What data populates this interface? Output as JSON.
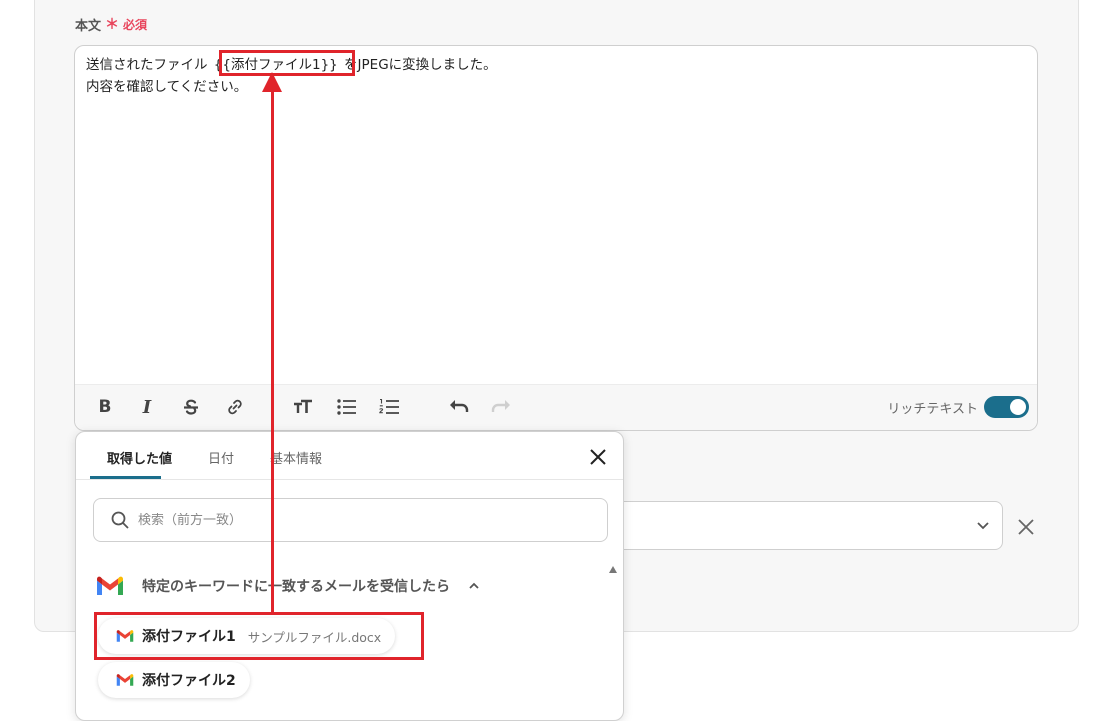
{
  "field": {
    "label": "本文",
    "required_mark": "＊",
    "required_text": "必須"
  },
  "editor": {
    "line1_before": "送信されたファイル ",
    "line1_token": "{{添付ファイル1}}",
    "line1_after": " をJPEGに変換しました。",
    "line2": "内容を確認してください。"
  },
  "toolbar": {
    "bold_label": "B",
    "italic_label": "I",
    "rich_text_label": "リッチテキスト",
    "rich_text_enabled": true,
    "icons": [
      "bold-icon",
      "italic-icon",
      "strikethrough-icon",
      "link-icon",
      "text-size-icon",
      "bullet-list-icon",
      "numbered-list-icon",
      "undo-icon",
      "redo-icon"
    ]
  },
  "popup": {
    "tabs": [
      {
        "label": "取得した値",
        "active": true
      },
      {
        "label": "日付",
        "active": false
      },
      {
        "label": "基本情報",
        "active": false
      }
    ],
    "search": {
      "placeholder": "検索（前方一致）"
    },
    "group": {
      "title": "特定のキーワードに一致するメールを受信したら",
      "expanded": true
    },
    "items": [
      {
        "label": "添付ファイル1",
        "value": "サンプルファイル.docx",
        "highlighted": true
      },
      {
        "label": "添付ファイル2",
        "value": ""
      }
    ]
  },
  "colors": {
    "accent": "#1b6e8c",
    "required": "#e8455c",
    "annotation": "#e0242b"
  }
}
